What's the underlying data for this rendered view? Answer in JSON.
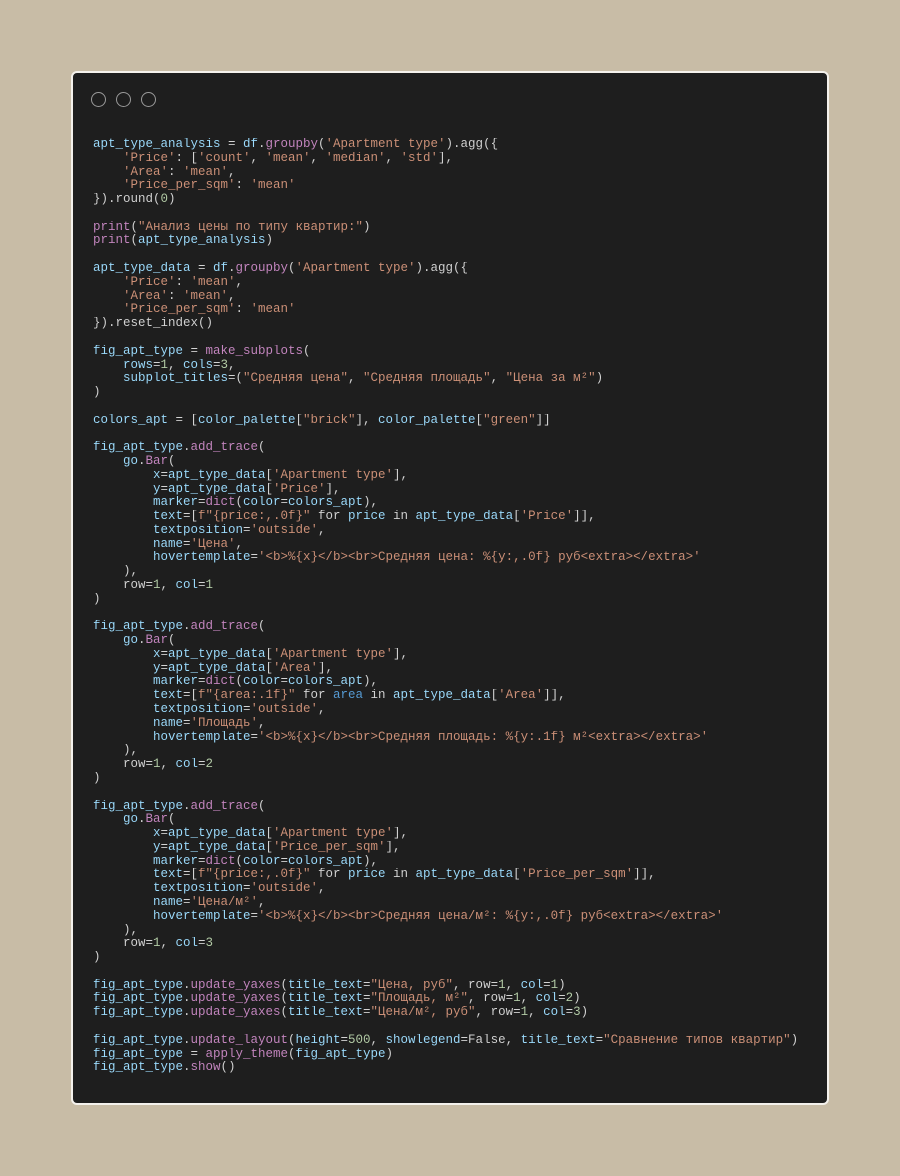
{
  "window": {
    "controls": [
      "circle",
      "circle",
      "circle"
    ]
  },
  "colors": {
    "background": "#c8bca6",
    "editor_bg": "#1e1e1e",
    "string": "#ce9178",
    "number": "#b5cea8",
    "function": "#c586c0",
    "identifier": "#9cdcfe"
  },
  "code": {
    "lines": [
      "apt_type_analysis = df.groupby('Apartment type').agg({",
      "    'Price': ['count', 'mean', 'median', 'std'],",
      "    'Area': 'mean',",
      "    'Price_per_sqm': 'mean'",
      "}).round(0)",
      "",
      "print(\"Анализ цены по типу квартир:\")",
      "print(apt_type_analysis)",
      "",
      "apt_type_data = df.groupby('Apartment type').agg({",
      "    'Price': 'mean',",
      "    'Area': 'mean',",
      "    'Price_per_sqm': 'mean'",
      "}).reset_index()",
      "",
      "fig_apt_type = make_subplots(",
      "    rows=1, cols=3,",
      "    subplot_titles=(\"Средняя цена\", \"Средняя площадь\", \"Цена за м²\")",
      ")",
      "",
      "colors_apt = [color_palette[\"brick\"], color_palette[\"green\"]]",
      "",
      "fig_apt_type.add_trace(",
      "    go.Bar(",
      "        x=apt_type_data['Apartment type'],",
      "        y=apt_type_data['Price'],",
      "        marker=dict(color=colors_apt),",
      "        text=[f\"{price:,.0f}\" for price in apt_type_data['Price']],",
      "        textposition='outside',",
      "        name='Цена',",
      "        hovertemplate='<b>%{x}</b><br>Средняя цена: %{y:,.0f} руб<extra></extra>'",
      "    ),",
      "    row=1, col=1",
      ")",
      "",
      "fig_apt_type.add_trace(",
      "    go.Bar(",
      "        x=apt_type_data['Apartment type'],",
      "        y=apt_type_data['Area'],",
      "        marker=dict(color=colors_apt),",
      "        text=[f\"{area:.1f}\" for area in apt_type_data['Area']],",
      "        textposition='outside',",
      "        name='Площадь',",
      "        hovertemplate='<b>%{x}</b><br>Средняя площадь: %{y:.1f} м²<extra></extra>'",
      "    ),",
      "    row=1, col=2",
      ")",
      "",
      "fig_apt_type.add_trace(",
      "    go.Bar(",
      "        x=apt_type_data['Apartment type'],",
      "        y=apt_type_data['Price_per_sqm'],",
      "        marker=dict(color=colors_apt),",
      "        text=[f\"{price:,.0f}\" for price in apt_type_data['Price_per_sqm']],",
      "        textposition='outside',",
      "        name='Цена/м²',",
      "        hovertemplate='<b>%{x}</b><br>Средняя цена/м²: %{y:,.0f} руб<extra></extra>'",
      "    ),",
      "    row=1, col=3",
      ")",
      "",
      "fig_apt_type.update_yaxes(title_text=\"Цена, руб\", row=1, col=1)",
      "fig_apt_type.update_yaxes(title_text=\"Площадь, м²\", row=1, col=2)",
      "fig_apt_type.update_yaxes(title_text=\"Цена/м², руб\", row=1, col=3)",
      "",
      "fig_apt_type.update_layout(height=500, showlegend=False, title_text=\"Сравнение типов квартир\")",
      "fig_apt_type = apply_theme(fig_apt_type)",
      "fig_apt_type.show()"
    ]
  }
}
